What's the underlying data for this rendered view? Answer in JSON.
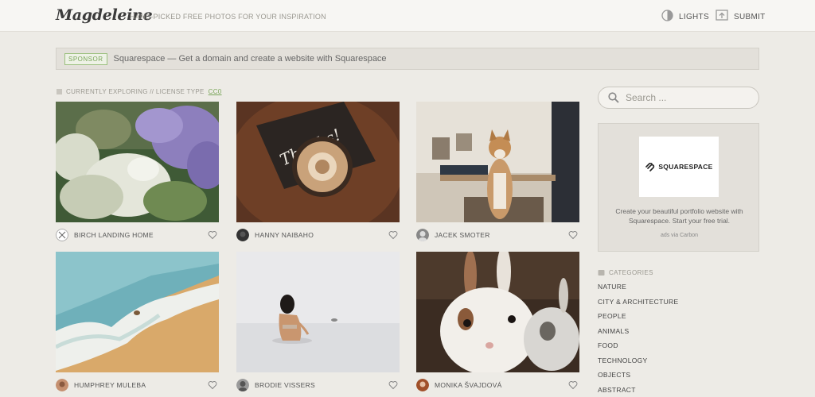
{
  "header": {
    "logo": "Magdeleine",
    "tagline": "HAND-PICKED FREE PHOTOS FOR YOUR INSPIRATION",
    "nav": [
      {
        "label": "LIGHTS",
        "icon": "lights-icon"
      },
      {
        "label": "SUBMIT",
        "icon": "submit-icon"
      }
    ]
  },
  "sponsor": {
    "badge": "SPONSOR",
    "text": "Squarespace — Get a domain and create a website with Squarespace"
  },
  "exploring": {
    "prefix": "CURRENTLY EXPLORING // LICENSE TYPE",
    "license": "CC0"
  },
  "photos": [
    {
      "author": "BIRCH LANDING HOME",
      "subject": "purple and white flowers"
    },
    {
      "author": "HANNY NAIBAHO",
      "subject": "coffee with thanks card"
    },
    {
      "author": "JACEK SMOTER",
      "subject": "cat on chair"
    },
    {
      "author": "HUMPHREY MULEBA",
      "subject": "beach wave"
    },
    {
      "author": "BRODIE VISSERS",
      "subject": "child in water"
    },
    {
      "author": "MONIKA ŠVAJDOVÁ",
      "subject": "rabbits"
    }
  ],
  "search": {
    "placeholder": "Search ..."
  },
  "ad": {
    "brand": "SQUARESPACE",
    "text": "Create your beautiful portfolio website with Squarespace. Start your free trial.",
    "via": "ads via Carbon"
  },
  "categories": {
    "header": "CATEGORIES",
    "items": [
      "NATURE",
      "CITY & ARCHITECTURE",
      "PEOPLE",
      "ANIMALS",
      "FOOD",
      "TECHNOLOGY",
      "OBJECTS",
      "ABSTRACT"
    ]
  },
  "colors": {
    "background": "#edebe6",
    "accent": "#7aa55a"
  }
}
